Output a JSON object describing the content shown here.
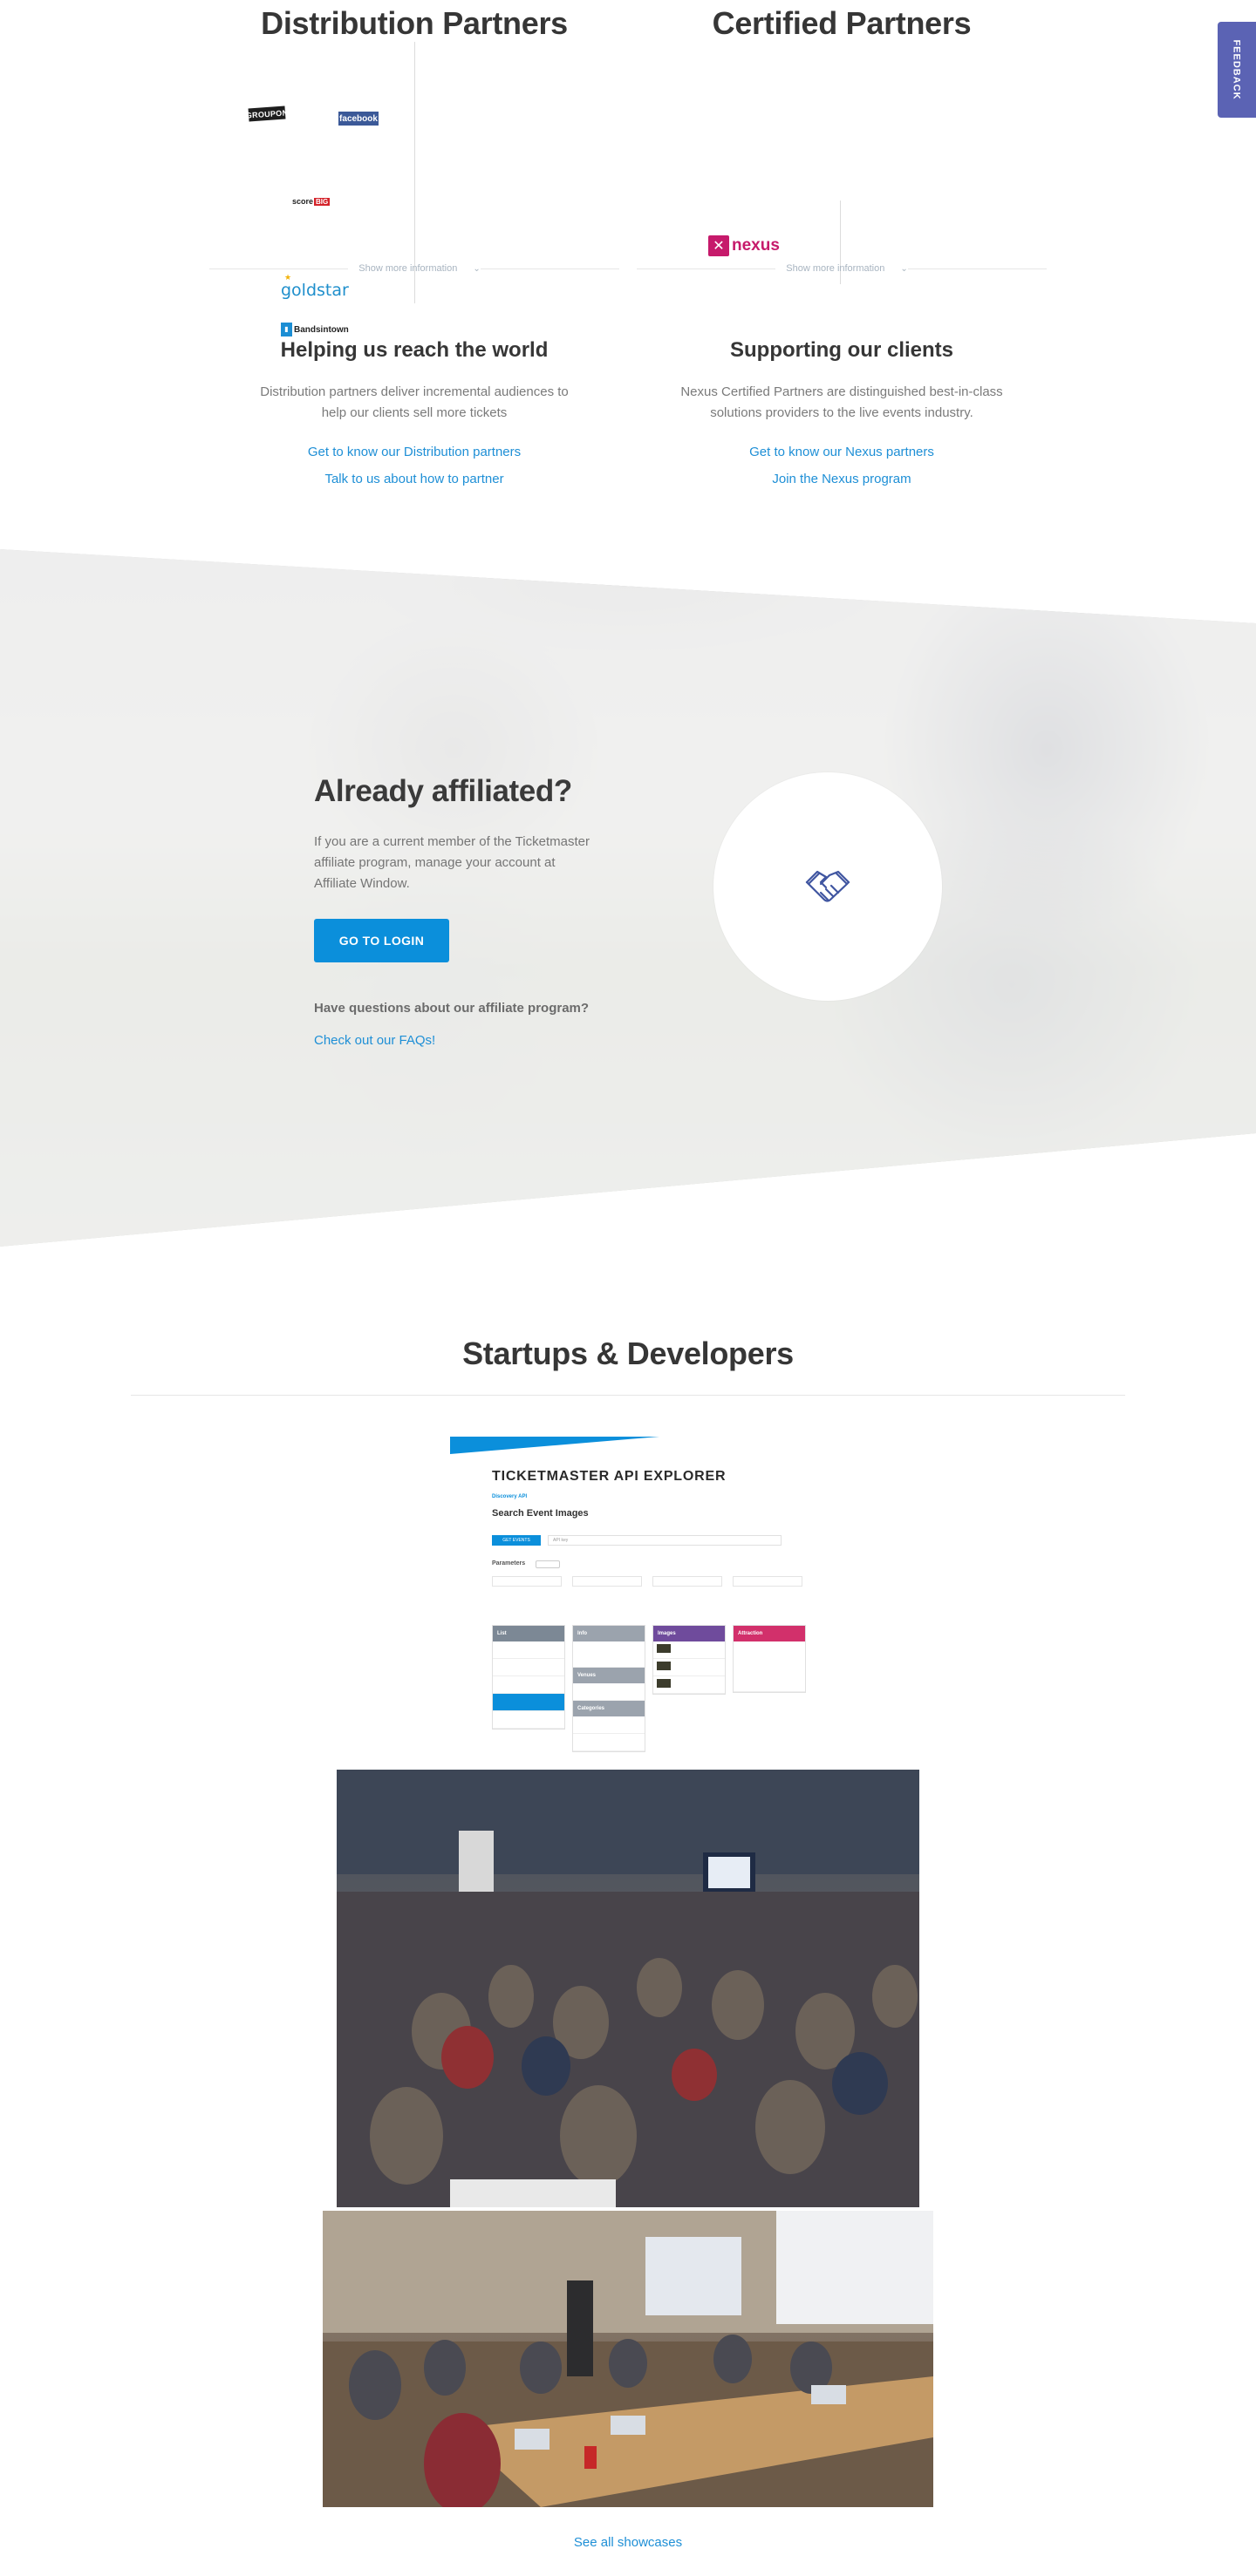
{
  "feedback": {
    "label": "FEEDBACK"
  },
  "partners": {
    "distribution": {
      "title": "Distribution Partners",
      "logos": {
        "groupon": "GROUPON",
        "facebook": "facebook",
        "score": "score",
        "score_big": "BIG",
        "goldstar": "goldstar",
        "bands": "Bandsintown"
      },
      "show_more": "Show more information",
      "subtitle": "Helping us reach the world",
      "description": "Distribution partners deliver incremental audiences to help our clients sell more tickets",
      "link_1": "Get to know our Distribution partners",
      "link_2": "Talk to us about how to partner"
    },
    "certified": {
      "title": "Certified Partners",
      "logos": {
        "nexus": "nexus"
      },
      "show_more": "Show more information",
      "subtitle": "Supporting our clients",
      "description": "Nexus Certified Partners are distinguished best-in-class solutions providers to the live events industry.",
      "link_1": "Get to know our Nexus partners",
      "link_2": "Join the Nexus program"
    }
  },
  "affiliate": {
    "title": "Already affiliated?",
    "description": "If you are a current member of the Ticketmaster affiliate program, manage your account at Affiliate Window.",
    "login_button": "GO TO LOGIN",
    "question": "Have questions about our affiliate program?",
    "faq_link": "Check out our FAQs!",
    "icon": "handshake-icon"
  },
  "startups": {
    "title": "Startups & Developers",
    "api_explorer": {
      "title": "TICKETMASTER API EXPLORER",
      "crumb": "Discovery API",
      "section": "Search Event Images",
      "button": "GET EVENTS",
      "field": "API key",
      "params": "Parameters",
      "cards": [
        {
          "name": "List",
          "color": "#7c8895"
        },
        {
          "name": "Info",
          "color": "#9ba3ad"
        },
        {
          "name": "Images",
          "color": "#6f4b9c"
        },
        {
          "name": "Attraction",
          "color": "#d2306b"
        }
      ],
      "venues": "Venues",
      "categories": "Categories"
    },
    "see_all": "See all showcases"
  },
  "colors": {
    "accent": "#0b8fdb",
    "link": "#1e8fd6",
    "feedback": "#5b63b4"
  }
}
